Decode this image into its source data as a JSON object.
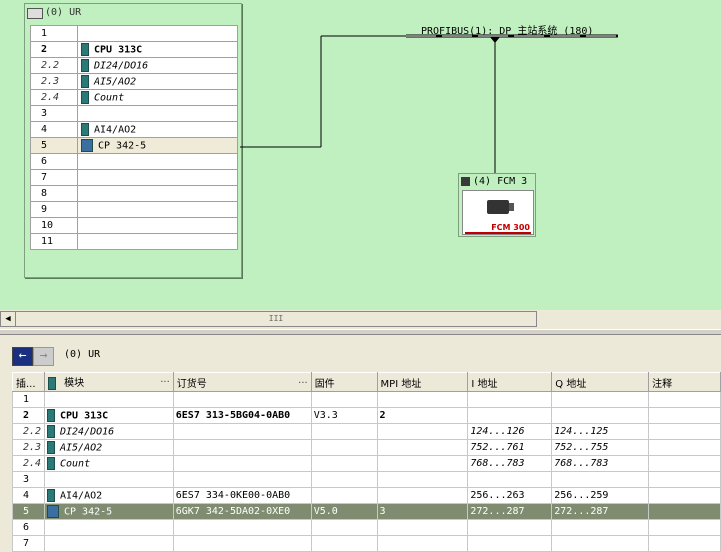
{
  "rack": {
    "title": "(0)  UR",
    "slots": [
      {
        "slot": "1",
        "module": "",
        "kind": "",
        "style": ""
      },
      {
        "slot": "2",
        "module": "CPU 313C",
        "kind": "cpu",
        "style": "bold"
      },
      {
        "slot": "2.2",
        "module": "DI24/DO16",
        "kind": "sub",
        "style": "italic"
      },
      {
        "slot": "2.3",
        "module": "AI5/AO2",
        "kind": "sub",
        "style": "italic"
      },
      {
        "slot": "2.4",
        "module": "Count",
        "kind": "sub",
        "style": "italic"
      },
      {
        "slot": "3",
        "module": "",
        "kind": "",
        "style": ""
      },
      {
        "slot": "4",
        "module": "AI4/AO2",
        "kind": "mod",
        "style": ""
      },
      {
        "slot": "5",
        "module": "CP 342-5",
        "kind": "cp",
        "style": "selected"
      },
      {
        "slot": "6",
        "module": "",
        "kind": "",
        "style": ""
      },
      {
        "slot": "7",
        "module": "",
        "kind": "",
        "style": ""
      },
      {
        "slot": "8",
        "module": "",
        "kind": "",
        "style": ""
      },
      {
        "slot": "9",
        "module": "",
        "kind": "",
        "style": ""
      },
      {
        "slot": "10",
        "module": "",
        "kind": "",
        "style": ""
      },
      {
        "slot": "11",
        "module": "",
        "kind": "",
        "style": ""
      }
    ]
  },
  "network": {
    "label": "PROFIBUS(1): DP 主站系统 (180)"
  },
  "fcm": {
    "title": "(4) FCM 3",
    "image_label": "FCM 300"
  },
  "scrollbar": {
    "thumb_label": "III"
  },
  "detail": {
    "title": "(0)    UR",
    "columns": [
      "插...",
      "模块",
      "订货号",
      "固件",
      "MPI 地址",
      "I 地址",
      "Q 地址",
      "注释"
    ],
    "rows": [
      {
        "slot": "1",
        "module": "",
        "order": "",
        "fw": "",
        "mpi": "",
        "i": "",
        "q": "",
        "comment": "",
        "kind": "empty"
      },
      {
        "slot": "2",
        "module": "CPU 313C",
        "order": "6ES7 313-5BG04-0AB0",
        "fw": "V3.3",
        "mpi": "2",
        "i": "",
        "q": "",
        "comment": "",
        "kind": "cpu"
      },
      {
        "slot": "2.2",
        "module": "DI24/DO16",
        "order": "",
        "fw": "",
        "mpi": "",
        "i": "124...126",
        "q": "124...125",
        "comment": "",
        "kind": "sub"
      },
      {
        "slot": "2.3",
        "module": "AI5/AO2",
        "order": "",
        "fw": "",
        "mpi": "",
        "i": "752...761",
        "q": "752...755",
        "comment": "",
        "kind": "sub"
      },
      {
        "slot": "2.4",
        "module": "Count",
        "order": "",
        "fw": "",
        "mpi": "",
        "i": "768...783",
        "q": "768...783",
        "comment": "",
        "kind": "sub"
      },
      {
        "slot": "3",
        "module": "",
        "order": "",
        "fw": "",
        "mpi": "",
        "i": "",
        "q": "",
        "comment": "",
        "kind": "empty"
      },
      {
        "slot": "4",
        "module": "AI4/AO2",
        "order": "6ES7 334-0KE00-0AB0",
        "fw": "",
        "mpi": "",
        "i": "256...263",
        "q": "256...259",
        "comment": "",
        "kind": "mod"
      },
      {
        "slot": "5",
        "module": "CP 342-5",
        "order": "6GK7 342-5DA02-0XE0",
        "fw": "V5.0",
        "mpi": "3",
        "i": "272...287",
        "q": "272...287",
        "comment": "",
        "kind": "cp"
      },
      {
        "slot": "6",
        "module": "",
        "order": "",
        "fw": "",
        "mpi": "",
        "i": "",
        "q": "",
        "comment": "",
        "kind": "empty"
      },
      {
        "slot": "7",
        "module": "",
        "order": "",
        "fw": "",
        "mpi": "",
        "i": "",
        "q": "",
        "comment": "",
        "kind": "empty"
      }
    ]
  },
  "colors": {
    "canvas": "#c0f0c0",
    "selected_row": "#7f8c70",
    "accent_red": "#c00000"
  }
}
